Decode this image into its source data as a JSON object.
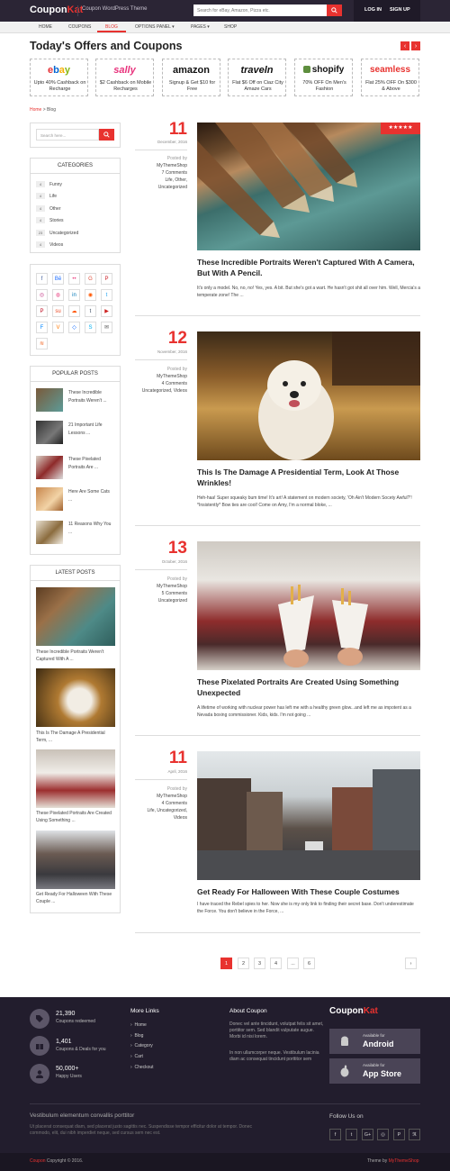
{
  "header": {
    "logo_part1": "Coupon",
    "logo_part2": "Kat",
    "tagline": "Coupon WordPress Theme",
    "search_placeholder": "Search for eBay, Amazon, Pizza etc.",
    "login": "LOG IN",
    "signup": "SIGN UP"
  },
  "nav": {
    "items": [
      "HOME",
      "COUPONS",
      "BLOG",
      "OPTIONS PANEL ▾",
      "PAGES ▾",
      "SHOP"
    ],
    "active": "BLOG"
  },
  "offers": {
    "title": "Today's Offers and Coupons",
    "items": [
      {
        "brand": "ebay",
        "text": "Upto 40% Cashback on Recharge",
        "color": "#e53238"
      },
      {
        "brand": "sally",
        "text": "$2 Cashback on Mobile Recharges",
        "color": "#e8327c"
      },
      {
        "brand": "amazon",
        "text": "Signup & Get $10 for Free",
        "color": "#111111"
      },
      {
        "brand": "traveln",
        "text": "Flat $6 Off on Ciaz City Amaze Cars",
        "color": "#111111"
      },
      {
        "brand": "shopify",
        "text": "70% OFF On Men's Fashion",
        "color": "#5e8e3e"
      },
      {
        "brand": "seamless",
        "text": "Flat 25% OFF On $300 & Above",
        "color": "#e8322f"
      }
    ]
  },
  "breadcrumb": {
    "home": "Home",
    "sep": ">",
    "current": "Blog"
  },
  "sidebar": {
    "search_placeholder": "Search here...",
    "categories_title": "CATEGORIES",
    "categories": [
      {
        "count": "4",
        "name": "Funny"
      },
      {
        "count": "4",
        "name": "Life"
      },
      {
        "count": "4",
        "name": "Other"
      },
      {
        "count": "4",
        "name": "Stories"
      },
      {
        "count": "23",
        "name": "Uncategorized"
      },
      {
        "count": "4",
        "name": "Videos"
      }
    ],
    "popular_title": "POPULAR POSTS",
    "popular": [
      "These Incredible Portraits Weren't ...",
      "21 Important Life Lessons ...",
      "These Pixelated Portraits Are ...",
      "Here Are Some Cats ...",
      "11 Reasons Why You ..."
    ],
    "latest_title": "LATEST POSTS",
    "latest": [
      "These Incredible Portraits Weren't Captured With A ...",
      "This Is The Damage A Presidential Term, ...",
      "These Pixelated Portraits Are Created Using Something ...",
      "Get Ready For Halloween With These Couple ..."
    ]
  },
  "posts": [
    {
      "day": "11",
      "month": "December, 2016",
      "posted_by": "Posted by",
      "author": "MyThemeShop",
      "comments": "7 Comments",
      "cats": "Life, Other, Uncategorized",
      "title": "These Incredible Portraits Weren't Captured With A Camera, But With A Pencil.",
      "excerpt": "It's only a model. No, no, no! Yes, yes. A bit. But she's got a wart. He hasn't got shit all over him. Well, Mercia's a temperate zone! The ...",
      "rating": "★★★★★"
    },
    {
      "day": "12",
      "month": "November, 2016",
      "posted_by": "Posted by",
      "author": "MyThemeShop",
      "comments": "4 Comments",
      "cats": "Uncategorized, Videos",
      "title": "This Is The Damage A Presidential Term, Look At Those Wrinkles!",
      "excerpt": "Heh-haa! Super squeaky bum time! It's art! A statement on modern society, 'Oh Ain't Modern Socety Awful?'! *Insistently* Bow ties are cool! Come on Amy, I'm a normal bloke, ..."
    },
    {
      "day": "13",
      "month": "October, 2016",
      "posted_by": "Posted by",
      "author": "MyThemeShop",
      "comments": "5 Comments",
      "cats": "Uncategorized",
      "title": "These Pixelated Portraits Are Created Using Something Unexpected",
      "excerpt": "A lifetime of working with nuclear power has left me with a healthy green glow...and left me as impotent as a Nevada boxing commissioner. Kids, kids. I'm not going ..."
    },
    {
      "day": "11",
      "month": "April, 2016",
      "posted_by": "Posted by",
      "author": "MyThemeShop",
      "comments": "4 Comments",
      "cats": "Life, Uncategorized, Videos",
      "title": "Get Ready For Halloween With These Couple Costumes",
      "excerpt": "I have traced the Rebel spies to her. Now she is my only link to finding their secret base. Don't underestimate the Force. You don't believe in the Force, ..."
    }
  ],
  "pagination": [
    "1",
    "2",
    "3",
    "4",
    "...",
    "6",
    "›"
  ],
  "footer": {
    "stats": [
      {
        "num": "21,390",
        "label": "Coupons redeemed"
      },
      {
        "num": "1,401",
        "label": "Coupons & Deals for you"
      },
      {
        "num": "50,000+",
        "label": "Happy Users"
      }
    ],
    "more_links_title": "More Links",
    "links": [
      "Home",
      "Blog",
      "Category",
      "Cart",
      "Checkout"
    ],
    "about_title": "About Coupon",
    "about_p1": "Donec vel ante tincidunt, volutpat felis sit amet, porttitor sem. Sed blandit vulputate augue. Morbi id nisi lorem.",
    "about_p2": "In non ullamcorper neque. Vestibulum lacinia diam ac consequat tincidunt porttitor sem",
    "logo_part1": "Coupon",
    "logo_part2": "Kat",
    "android_small": "Available for",
    "android_big": "Android",
    "appstore_small": "Available for",
    "appstore_big": "App Store",
    "bottom_title": "Vestibulum elementum convallis porttitor",
    "bottom_text": "Ut placerat consequat diam, sed placerat justo sagittis nec. Suspendisse tempor efficitur dolor at tempor. Donec commodo, elit, dui nibh imperdiet neque, sed cursus sem nec est.",
    "follow_title": "Follow Us on",
    "social": [
      "f",
      "t",
      "G+",
      "◎",
      "P",
      "ℜ"
    ],
    "copyright_brand": "Coupon",
    "copyright_rest": " Copyright © 2016.",
    "theme_by": "Theme by ",
    "theme_brand": "MyThemeShop"
  },
  "colors": {
    "accent": "#e8322f",
    "dark": "#2b2535"
  }
}
